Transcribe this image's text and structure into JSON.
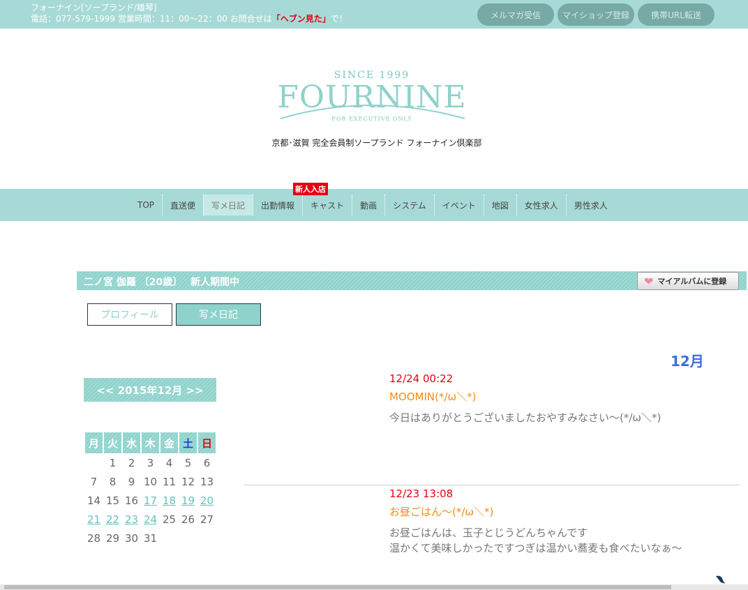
{
  "header": {
    "shop_name": "フォーナイン[ソープランド/雄琴]",
    "contact_prefix": "電話：077-579-1999 営業時間：11：00～22：00 お問合せは",
    "contact_highlight": "「ヘブン見た」",
    "contact_suffix": "で！",
    "buttons": [
      "メルマガ受信",
      "マイショップ登録",
      "携帯URL転送"
    ]
  },
  "logo": {
    "since": "SINCE 1999",
    "brand": "FOURNINE",
    "tagline": "FOR EXECUTIVE ONLY",
    "subtitle": "京都･滋賀 完全会員制ソープランド フォーナイン倶楽部"
  },
  "nav": {
    "items": [
      "TOP",
      "直送便",
      "写メ日記",
      "出勤情報",
      "キャスト",
      "動画",
      "システム",
      "イベント",
      "地図",
      "女性求人",
      "男性求人"
    ],
    "active": "写メ日記",
    "new_badge": "新人入店"
  },
  "profile": {
    "title": "二ノ宮 伽羅 〔20歳〕　 新人期間中",
    "album_button": "マイアルバムに登録",
    "tabs": [
      "プロフィール",
      "写メ日記"
    ]
  },
  "calendar": {
    "header": "<< 2015年12月 >>",
    "weekdays": [
      "月",
      "火",
      "水",
      "木",
      "金",
      "土",
      "日"
    ],
    "weeks": [
      [
        "",
        "1",
        "2",
        "3",
        "4",
        "5",
        "6"
      ],
      [
        "7",
        "8",
        "9",
        "10",
        "11",
        "12",
        "13"
      ],
      [
        "14",
        "15",
        "16",
        "17",
        "18",
        "19",
        "20"
      ],
      [
        "21",
        "22",
        "23",
        "24",
        "25",
        "26",
        "27"
      ],
      [
        "28",
        "29",
        "30",
        "31",
        "",
        "",
        ""
      ]
    ],
    "linked_days": [
      "17",
      "18",
      "19",
      "20",
      "21",
      "22",
      "23",
      "24"
    ]
  },
  "diary": {
    "month": "12月",
    "entries": [
      {
        "date": "12/24 00:22",
        "title": "MOOMIN(*/ω＼*)",
        "body": [
          "今日はありがとうございましたおやすみなさい～(*/ω＼*)"
        ]
      },
      {
        "date": "12/23 13:08",
        "title": "お昼ごはん～(*/ω＼*)",
        "body": [
          "お昼ごはんは、玉子とじうどんちゃんです",
          "温かくて美味しかったですつぎは温かい蕎麦も食べたいなぁ～"
        ]
      }
    ]
  },
  "colors": {
    "teal": "#a7dad6",
    "teal_dark": "#8fd2cb",
    "red": "#e60012",
    "orange": "#f08c1a",
    "blue": "#3a6fd8"
  }
}
